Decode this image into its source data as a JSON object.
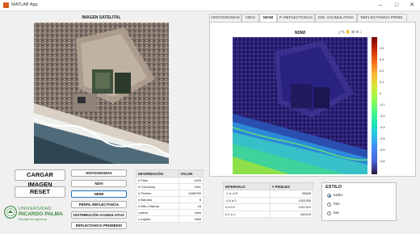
{
  "window": {
    "title": "MATLAB App"
  },
  "satellite": {
    "title": "IMAGEN SATELITAL"
  },
  "buttons": {
    "cargar": "CARGAR IMAGEN",
    "reset": "RESET",
    "histogramas": "HISTOGRAMAS",
    "ndvi": "NDVI",
    "ndwi": "NDWI",
    "perfil": "PERFIL REFLECTANCIA",
    "distribucion": "DISTRIBUCIÓN ACUMULATIVA",
    "reflectancia": "REFLECTANCIA PROMEDIO"
  },
  "logo": {
    "line1": "UNIVERSIDAD",
    "line2": "RICARDO PALMA",
    "line3": "Facultad de Ingeniería"
  },
  "info": {
    "headers": [
      "INFORMACIÓN",
      "VALOR"
    ],
    "rows": [
      [
        "# Filas",
        "1005"
      ],
      [
        "# Columnas",
        "1061"
      ],
      [
        "# Pixeles",
        "3468750"
      ],
      [
        "# Bandas",
        "5"
      ],
      [
        "# Bits x Banda",
        "16"
      ],
      [
        "Latitud",
        "NaN"
      ],
      [
        "Longitud",
        "NaN"
      ]
    ]
  },
  "tabs": [
    "HISTOGRAMAS",
    "NDVI",
    "NDWI",
    "P. REFLECTANCIA",
    "DIS. ACUMULATIVA",
    "REFLECTANCIA PROM."
  ],
  "active_tab": "NDWI",
  "plot": {
    "title": "NDWI",
    "colorbar_ticks": [
      "0.4",
      "0.3",
      "0.2",
      "0.1",
      "0",
      "-0.1",
      "-0.2",
      "-0.3",
      "-0.4",
      "-0.5",
      "-0.6"
    ],
    "toolbar_icons": [
      "export-icon",
      "brush-icon",
      "pan-icon",
      "zoom-in-icon",
      "zoom-out-icon",
      "home-icon"
    ]
  },
  "intervals": {
    "headers": [
      "INTERVALO",
      "# PIXELES"
    ],
    "rows": [
      [
        "-1 a -0.5",
        "55665"
      ],
      [
        "-0.5 a 0",
        "1920355"
      ],
      [
        "0 a 0.2",
        "1037310"
      ],
      [
        "0.2 a 1",
        "452403"
      ]
    ]
  },
  "estilo": {
    "title": "ESTILO",
    "options": [
      "turbo",
      "hsv",
      "hot"
    ],
    "selected": "turbo"
  },
  "colors": {
    "accent": "#1a73c8",
    "satellite_sea": "#3e5a68",
    "ndwi_sea": "#3bd0c0",
    "ndwi_land": "#2a1f6b"
  }
}
